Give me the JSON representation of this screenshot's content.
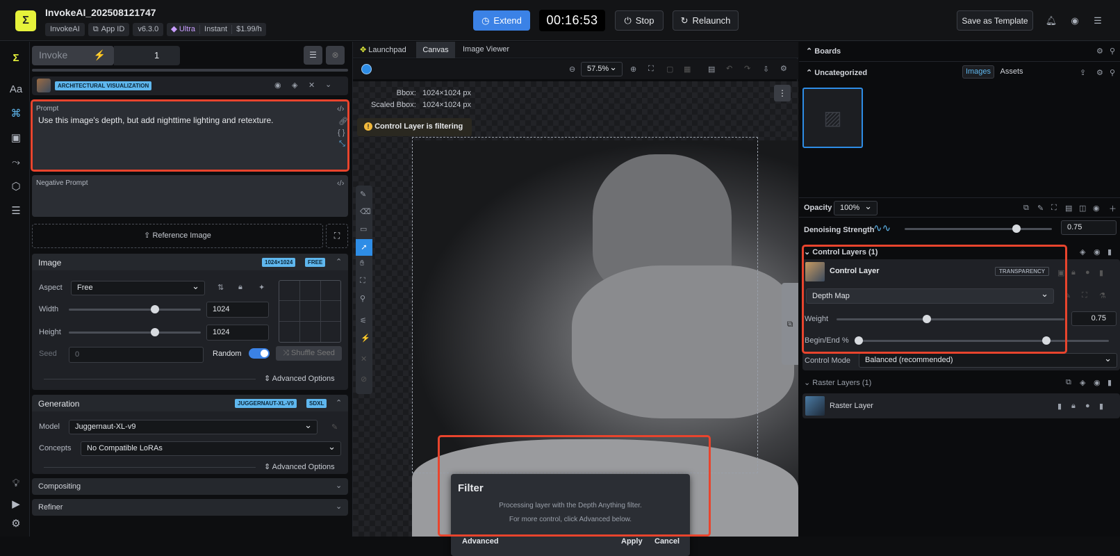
{
  "app": {
    "title": "InvokeAI_202508121747",
    "chips": [
      "InvokeAI",
      "App ID",
      "v6.3.0"
    ],
    "plan": [
      "Ultra",
      "Instant",
      "$1.99/h"
    ],
    "timer": "00:16:53",
    "extend": "Extend",
    "stop": "Stop",
    "relaunch": "Relaunch",
    "save_template": "Save as Template",
    "colors": {
      "accent": "#3b82e6",
      "highlight": "#e8442d",
      "badge": "#5fb7ee"
    }
  },
  "left": {
    "invoke_label": "Invoke",
    "batch": "1",
    "style_badge": "ARCHITECTURAL VISUALIZATION",
    "prompt_label": "Prompt",
    "prompt_text": "Use this image's depth, but add nighttime lighting and retexture.",
    "neg_label": "Negative Prompt",
    "ref_image": "Reference Image",
    "image": {
      "title": "Image",
      "size_badge": "1024×1024",
      "free_badge": "FREE",
      "aspect_label": "Aspect",
      "aspect_value": "Free",
      "width_label": "Width",
      "width_value": "1024",
      "height_label": "Height",
      "height_value": "1024",
      "seed_label": "Seed",
      "seed_value": "0",
      "random_label": "Random",
      "random_on": true,
      "shuffle": "Shuffle Seed",
      "advanced": "Advanced Options"
    },
    "generation": {
      "title": "Generation",
      "model_badge": "JUGGERNAUT-XL-V9",
      "arch_badge": "SDXL",
      "model_label": "Model",
      "model_value": "Juggernaut-XL-v9",
      "concepts_label": "Concepts",
      "concepts_value": "No Compatible LoRAs",
      "advanced": "Advanced Options"
    },
    "compositing": "Compositing",
    "refiner": "Refiner"
  },
  "canvas": {
    "tabs": [
      "Launchpad",
      "Canvas",
      "Image Viewer"
    ],
    "active_tab": "Canvas",
    "zoom": "57.5%",
    "bbox_label": "Bbox:",
    "bbox_value": "1024×1024 px",
    "scaled_label": "Scaled Bbox:",
    "scaled_value": "1024×1024 px",
    "filtering": "Control Layer is filtering",
    "filter": {
      "title": "Filter",
      "line1": "Processing layer with the Depth Anything filter.",
      "line2": "For more control, click Advanced below.",
      "advanced": "Advanced",
      "apply": "Apply",
      "cancel": "Cancel"
    }
  },
  "right": {
    "boards": "Boards",
    "uncategorized": "Uncategorized",
    "images_tab": "Images",
    "assets_tab": "Assets",
    "opacity_label": "Opacity",
    "opacity_value": "100%",
    "denoise_label": "Denoising Strength",
    "denoise_value": "0.75",
    "denoise_level": 0.75,
    "control_layers": "Control Layers (1)",
    "control_layer": "Control Layer",
    "transparency": "TRANSPARENCY",
    "depth_map": "Depth Map",
    "weight_label": "Weight",
    "weight_value": "0.75",
    "weight_level": 0.38,
    "begin_end_label": "Begin/End %",
    "begin_level": 0,
    "end_level": 0.75,
    "control_mode_label": "Control Mode",
    "control_mode_value": "Balanced (recommended)",
    "raster_layers": "Raster Layers (1)",
    "raster_layer": "Raster Layer"
  }
}
